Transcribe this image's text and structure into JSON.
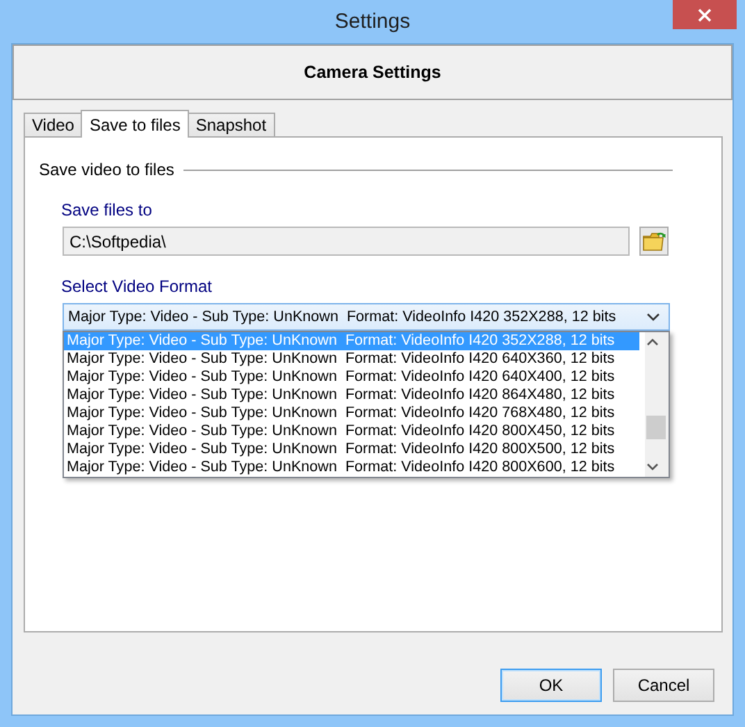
{
  "window": {
    "title": "Settings"
  },
  "header": {
    "title": "Camera Settings"
  },
  "tabs": [
    {
      "label": "Video",
      "selected": false
    },
    {
      "label": "Save to files",
      "selected": true
    },
    {
      "label": "Snapshot",
      "selected": false
    }
  ],
  "group": {
    "title": "Save video to files"
  },
  "save_path": {
    "label": "Save files to",
    "value": "C:\\Softpedia\\"
  },
  "video_format": {
    "label": "Select Video Format",
    "value": "Major Type: Video - Sub Type: UnKnown  Format: VideoInfo I420 352X288, 12 bits",
    "expanded": true,
    "options": [
      {
        "label": "Major Type: Video - Sub Type: UnKnown  Format: VideoInfo I420 352X288, 12 bits",
        "selected": true
      },
      {
        "label": "Major Type: Video - Sub Type: UnKnown  Format: VideoInfo I420 640X360, 12 bits",
        "selected": false
      },
      {
        "label": "Major Type: Video - Sub Type: UnKnown  Format: VideoInfo I420 640X400, 12 bits",
        "selected": false
      },
      {
        "label": "Major Type: Video - Sub Type: UnKnown  Format: VideoInfo I420 864X480, 12 bits",
        "selected": false
      },
      {
        "label": "Major Type: Video - Sub Type: UnKnown  Format: VideoInfo I420 768X480, 12 bits",
        "selected": false
      },
      {
        "label": "Major Type: Video - Sub Type: UnKnown  Format: VideoInfo I420 800X450, 12 bits",
        "selected": false
      },
      {
        "label": "Major Type: Video - Sub Type: UnKnown  Format: VideoInfo I420 800X500, 12 bits",
        "selected": false
      },
      {
        "label": "Major Type: Video - Sub Type: UnKnown  Format: VideoInfo I420 800X600, 12 bits",
        "selected": false
      }
    ]
  },
  "buttons": [
    {
      "label": "OK",
      "default": true
    },
    {
      "label": "Cancel",
      "default": false
    }
  ]
}
